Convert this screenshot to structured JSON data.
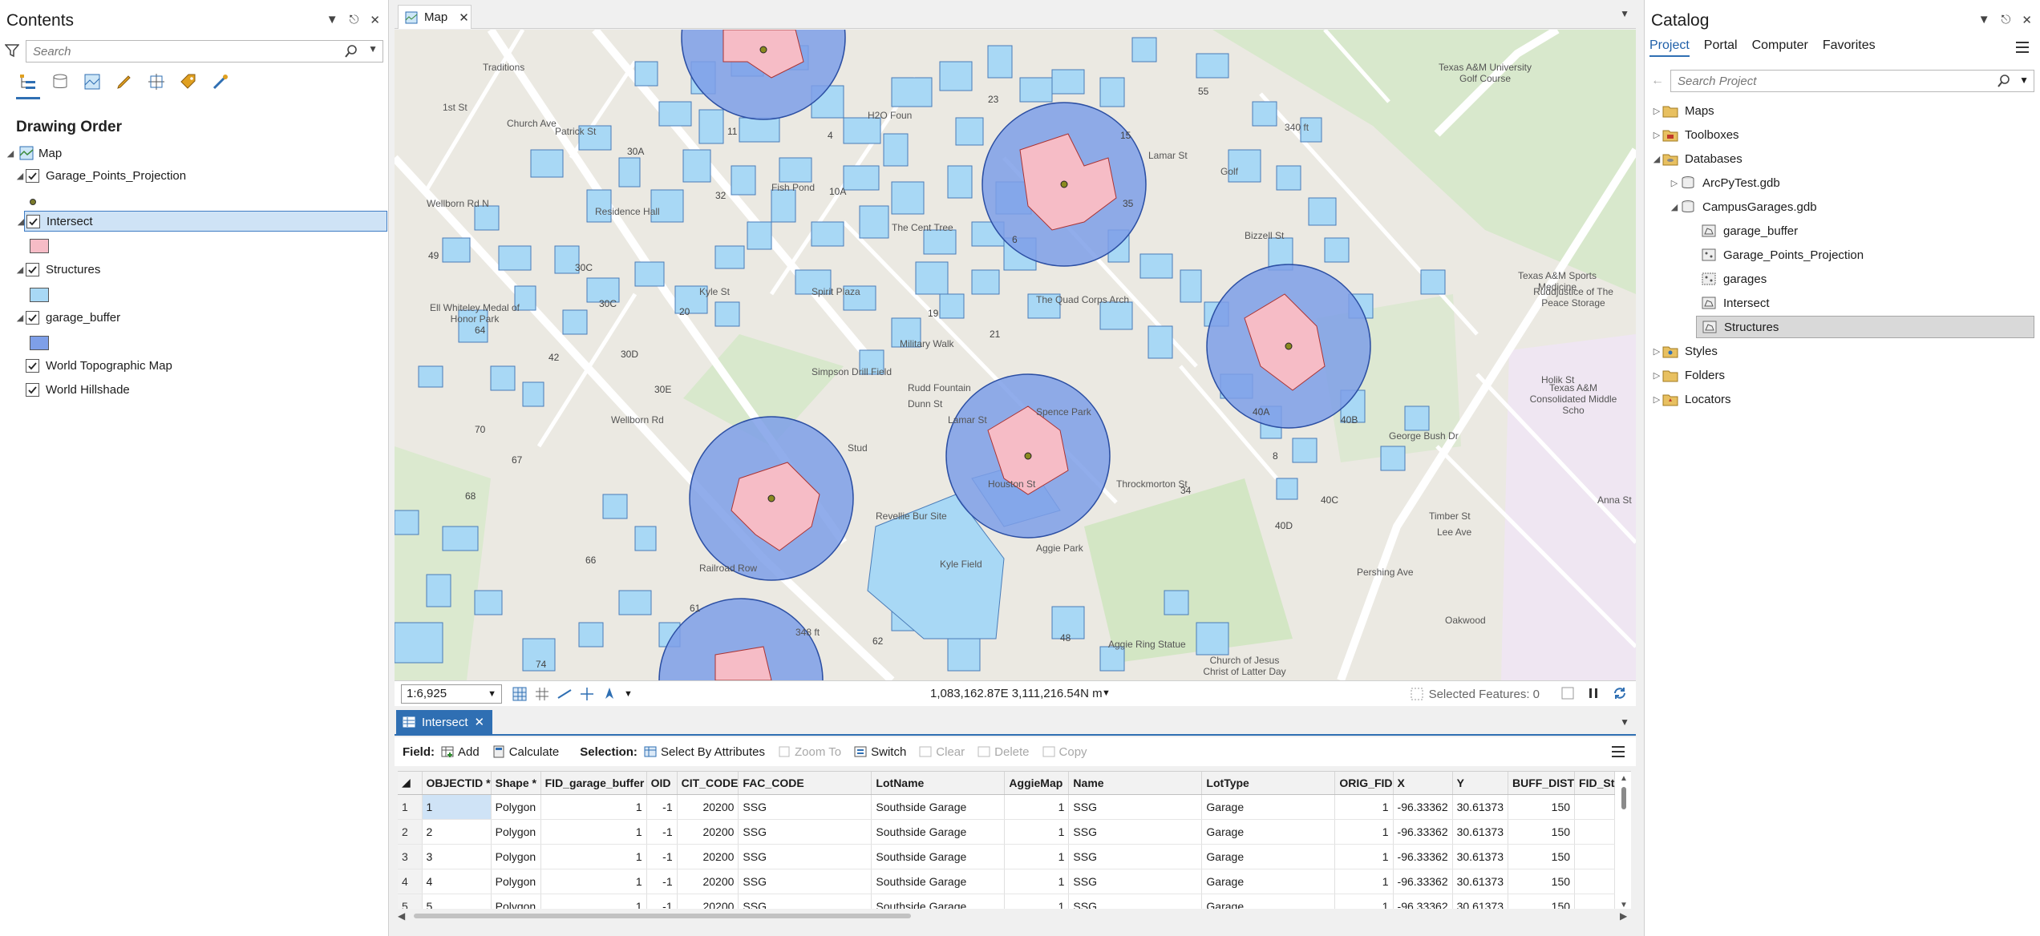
{
  "contents": {
    "title": "Contents",
    "search_placeholder": "Search",
    "section": "Drawing Order",
    "layers": [
      {
        "label": "Map",
        "checked": false
      },
      {
        "label": "Garage_Points_Projection",
        "checked": true
      },
      {
        "label": "Intersect",
        "checked": true
      },
      {
        "label": "Structures",
        "checked": true
      },
      {
        "label": "garage_buffer",
        "checked": true
      },
      {
        "label": "World Topographic Map",
        "checked": true
      },
      {
        "label": "World Hillshade",
        "checked": true
      }
    ]
  },
  "map": {
    "tab_label": "Map",
    "scale": "1:6,925",
    "coordinates": "1,083,162.87E 3,111,216.54N m",
    "selected_features": "Selected Features: 0",
    "labels": [
      "Traditions",
      "1st St",
      "Church Ave",
      "Patrick St",
      "Wellborn Rd N",
      "Fish Pond",
      "H2O Foun",
      "Residence Hall",
      "The Cent Tree",
      "Spirit Plaza",
      "Ell Whiteley Medal of Honor Park",
      "The Quad Corps Arch",
      "Simpson Drill Field",
      "Military Walk",
      "Rudd Fountain",
      "Spence Park",
      "Throckmorton St",
      "Houston St",
      "Lamar St",
      "Revellie Bur Site",
      "Railroad Row",
      "Aggie Park",
      "Kyle Field",
      "Aggie Ring Statue",
      "Church of Jesus Christ of Latter Day",
      "Oakwood",
      "Texas A&M University Golf Course",
      "Golf",
      "Bizzell St",
      "Texas A&M Sports Medicine",
      "Ruddjustice of The Peace Storage",
      "Texas A&M Consolidated Middle Scho",
      "George Bush Dr",
      "Holik St",
      "Timber St",
      "Lee Ave",
      "Pershing Ave",
      "Anna St",
      "340 ft",
      "348 ft",
      "Wellborn Rd",
      "Dunn St",
      "Kyle St",
      "Lamar St",
      "Stud"
    ],
    "numbers": [
      "11",
      "4",
      "23",
      "55",
      "30A",
      "32",
      "10A",
      "6",
      "35",
      "49",
      "30C",
      "30C",
      "20",
      "19",
      "21",
      "64",
      "42",
      "30D",
      "30E",
      "70",
      "67",
      "68",
      "66",
      "61",
      "74",
      "62",
      "48",
      "34",
      "40A",
      "40B",
      "8",
      "40C",
      "40D",
      "15"
    ]
  },
  "table": {
    "tab_label": "Intersect",
    "toolbar": {
      "field_label": "Field:",
      "add": "Add",
      "calculate": "Calculate",
      "selection_label": "Selection:",
      "select_by_attributes": "Select By Attributes",
      "zoom_to": "Zoom To",
      "switch": "Switch",
      "clear": "Clear",
      "delete": "Delete",
      "copy": "Copy"
    },
    "columns": [
      "OBJECTID *",
      "Shape *",
      "FID_garage_buffer",
      "OID",
      "CIT_CODE",
      "FAC_CODE",
      "LotName",
      "AggieMap",
      "Name",
      "LotType",
      "ORIG_FID",
      "X",
      "Y",
      "BUFF_DIST",
      "FID_St"
    ],
    "rows": [
      [
        "1",
        "1",
        "Polygon",
        "1",
        "-1",
        "20200",
        "SSG",
        "Southside Garage",
        "1",
        "SSG",
        "Garage",
        "1",
        "-96.33362",
        "30.61373",
        "150"
      ],
      [
        "2",
        "2",
        "Polygon",
        "1",
        "-1",
        "20200",
        "SSG",
        "Southside Garage",
        "1",
        "SSG",
        "Garage",
        "1",
        "-96.33362",
        "30.61373",
        "150"
      ],
      [
        "3",
        "3",
        "Polygon",
        "1",
        "-1",
        "20200",
        "SSG",
        "Southside Garage",
        "1",
        "SSG",
        "Garage",
        "1",
        "-96.33362",
        "30.61373",
        "150"
      ],
      [
        "4",
        "4",
        "Polygon",
        "1",
        "-1",
        "20200",
        "SSG",
        "Southside Garage",
        "1",
        "SSG",
        "Garage",
        "1",
        "-96.33362",
        "30.61373",
        "150"
      ],
      [
        "5",
        "5",
        "Polygon",
        "1",
        "-1",
        "20200",
        "SSG",
        "Southside Garage",
        "1",
        "SSG",
        "Garage",
        "1",
        "-96.33362",
        "30.61373",
        "150"
      ]
    ]
  },
  "catalog": {
    "title": "Catalog",
    "tabs": [
      "Project",
      "Portal",
      "Computer",
      "Favorites"
    ],
    "search_placeholder": "Search Project",
    "items": [
      "Maps",
      "Toolboxes",
      "Databases",
      "ArcPyTest.gdb",
      "CampusGarages.gdb",
      "garage_buffer",
      "Garage_Points_Projection",
      "garages",
      "Intersect",
      "Structures",
      "Styles",
      "Folders",
      "Locators"
    ]
  },
  "colors": {
    "accent": "#2f6fb3",
    "buffer_fill": "#7e9fe8",
    "structure_fill": "#a8d8f5",
    "intersect_fill": "#f6bcc6",
    "selection": "#cfe3f6"
  }
}
